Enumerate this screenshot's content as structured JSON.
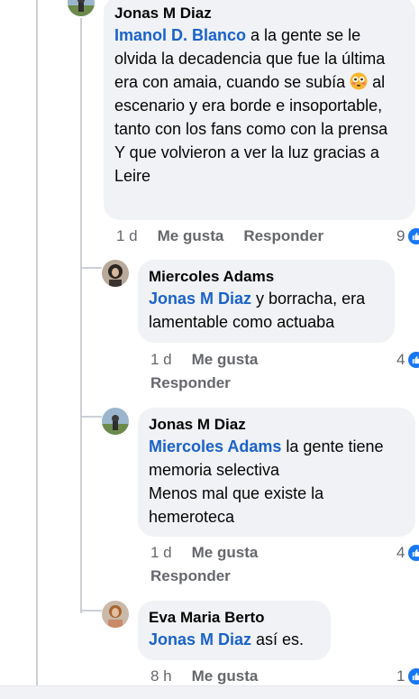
{
  "comments": [
    {
      "author": "Jonas M Diaz",
      "mention": "Imanol D. Blanco",
      "text_part1": " a la gente se le olvida la decadencia que fue la última era con amaia, cuando se subía ",
      "emoji": "flushed-face-emoji",
      "text_part2": " al escenario y era borde e insoportable, tanto con los fans como con la prensa\nY que volvieron a ver la luz gracias a Leire",
      "time": "1 d",
      "like": "Me gusta",
      "reply": "Responder",
      "reactions": "9"
    },
    {
      "author": "Miercoles Adams",
      "mention": "Jonas M Diaz",
      "text": " y borracha, era lamentable como actuaba",
      "time": "1 d",
      "like": "Me gusta",
      "reply": "Responder",
      "reactions": "4"
    },
    {
      "author": "Jonas M Diaz",
      "mention": "Miercoles Adams",
      "text": " la gente tiene memoria selectiva\nMenos mal que existe la hemeroteca",
      "time": "1 d",
      "like": "Me gusta",
      "reply": "Responder",
      "reactions": "4"
    },
    {
      "author": "Eva Maria Berto",
      "mention": "Jonas M Diaz",
      "text": " así es.",
      "time": "8 h",
      "like": "Me gusta",
      "reactions": "1"
    }
  ],
  "colors": {
    "mention": "#1a62c8",
    "bubble": "#f0f2f5",
    "meta": "#65676b",
    "like_badge": "#1877f2"
  }
}
